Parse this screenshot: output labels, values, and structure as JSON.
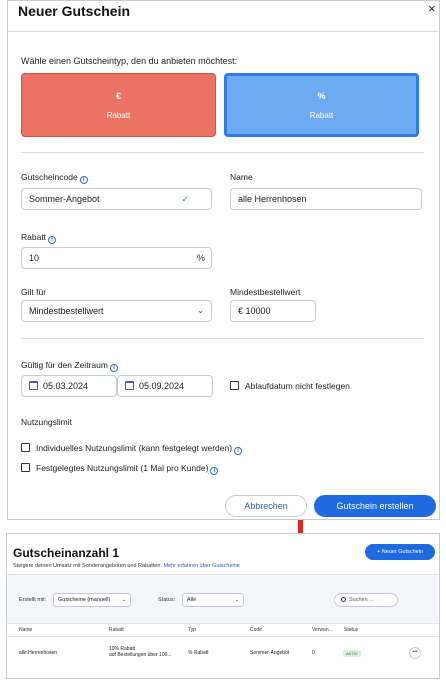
{
  "dialog": {
    "title": "Neuer Gutschein",
    "close": "×",
    "subhead": "Wähle einen Gutscheintyp, den du anbieten möchtest:",
    "types": [
      {
        "symbol": "€",
        "label": "Rabatt",
        "color": "#ec7264",
        "selected": false
      },
      {
        "symbol": "%",
        "label": "Rabatt",
        "color": "#6eaaf2",
        "selected": true
      }
    ],
    "code": {
      "label": "Gutscheincode",
      "value": "Sommer-Angebot",
      "valid": true
    },
    "name": {
      "label": "Name",
      "value": "alle Herrenhosen"
    },
    "discount": {
      "label": "Rabatt",
      "value": "10",
      "unit": "%"
    },
    "applies": {
      "label": "Gilt für",
      "value": "Mindestbestellwert"
    },
    "min_order": {
      "label": "Mindestbestellwert",
      "value": "€ 10000"
    },
    "period": {
      "label": "Gültig für den Zeitraum",
      "start": "05.03.2024",
      "end": "05.09.2024",
      "no_expiry_label": "Ablaufdatum nicht festlegen",
      "no_expiry_checked": false
    },
    "limit": {
      "heading": "Nutzungslimit",
      "options": [
        {
          "label": "Individuelles Nutzungslimit (kann festgelegt werden)",
          "checked": false
        },
        {
          "label": "Festgelegtes Nutzungslimit (1 Mal pro Kunde)",
          "checked": false
        }
      ]
    },
    "cancel_label": "Abbrechen",
    "create_label": "Gutschein erstellen",
    "accent": "#1f6ae0"
  },
  "list": {
    "title": "Gutscheinanzahl 1",
    "subtitle": "Steigere deinen Umsatz mit Sonderangeboten und Rabatten.",
    "subtitle_link": "Mehr erfahren über Gutscheine",
    "new_button": "+ Neuer Gutschein",
    "filters": {
      "created_label": "Erstellt mit:",
      "created_value": "Gutscheine (manuell)",
      "status_label": "Status:",
      "status_value": "Alle",
      "search_placeholder": "Suchen ..."
    },
    "columns": [
      "Name",
      "Rabatt",
      "Typ",
      "Code",
      "Verwen...",
      "Status"
    ],
    "rows": [
      {
        "name": "alle Herrenhosen",
        "discount_line1": "10% Rabatt",
        "discount_line2": "auf Bestellungen über 100...",
        "type": "% Rabatt",
        "code": "Sommer-Angebot",
        "uses": "0",
        "status": "AKTIV",
        "more": "•••"
      }
    ]
  },
  "arrow_color": "#e2231a"
}
